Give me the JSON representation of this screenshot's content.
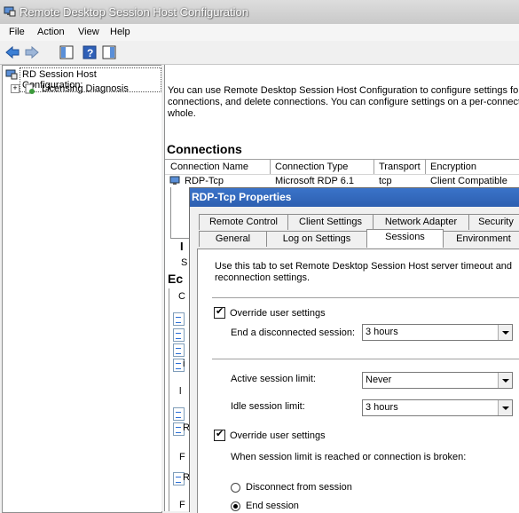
{
  "window": {
    "title": "Remote Desktop Session Host Configuration"
  },
  "menu": [
    "File",
    "Action",
    "View",
    "Help"
  ],
  "tree": {
    "root": "RD Session Host Configuration:",
    "child": "Licensing Diagnosis"
  },
  "main": {
    "description_lines": [
      "You can use Remote Desktop Session Host Configuration to configure settings for nev",
      "connections, and delete connections. You can configure settings on a per-connection",
      "whole."
    ],
    "connections_title": "Connections",
    "columns": [
      "Connection Name",
      "Connection Type",
      "Transport",
      "Encryption"
    ],
    "row": [
      "RDP-Tcp",
      "Microsoft RDP 6.1",
      "tcp",
      "Client Compatible"
    ],
    "partial_heading_1": "I",
    "partial_heading_2": "Ec",
    "partial_glyph_s": "S",
    "partial_glyph_c": "C",
    "partial_glyph_l": "l",
    "partial_glyph_f": "F",
    "partial_glyph_i": "i",
    "partial_glyph_r": "R"
  },
  "dialog": {
    "title": "RDP-Tcp Properties",
    "tabs_row1": [
      "Remote Control",
      "Client Settings",
      "Network Adapter",
      "Security"
    ],
    "tabs_row2": [
      "General",
      "Log on Settings",
      "Sessions",
      "Environment"
    ],
    "active_tab": "Sessions",
    "intro_lines": [
      "Use this tab to set Remote Desktop Session Host server timeout and",
      "reconnection settings."
    ],
    "override1_label": "Override user settings",
    "override1_checked": true,
    "end_disconnected_label": "End a disconnected session:",
    "end_disconnected_value": "3 hours",
    "active_limit_label": "Active session limit:",
    "active_limit_value": "Never",
    "idle_limit_label": "Idle session limit:",
    "idle_limit_value": "3 hours",
    "override2_label": "Override user settings",
    "override2_checked": true,
    "limit_reached_label": "When session limit is reached or connection is broken:",
    "radio_disconnect": "Disconnect from session",
    "radio_end": "End session",
    "selected_radio": "End session"
  }
}
